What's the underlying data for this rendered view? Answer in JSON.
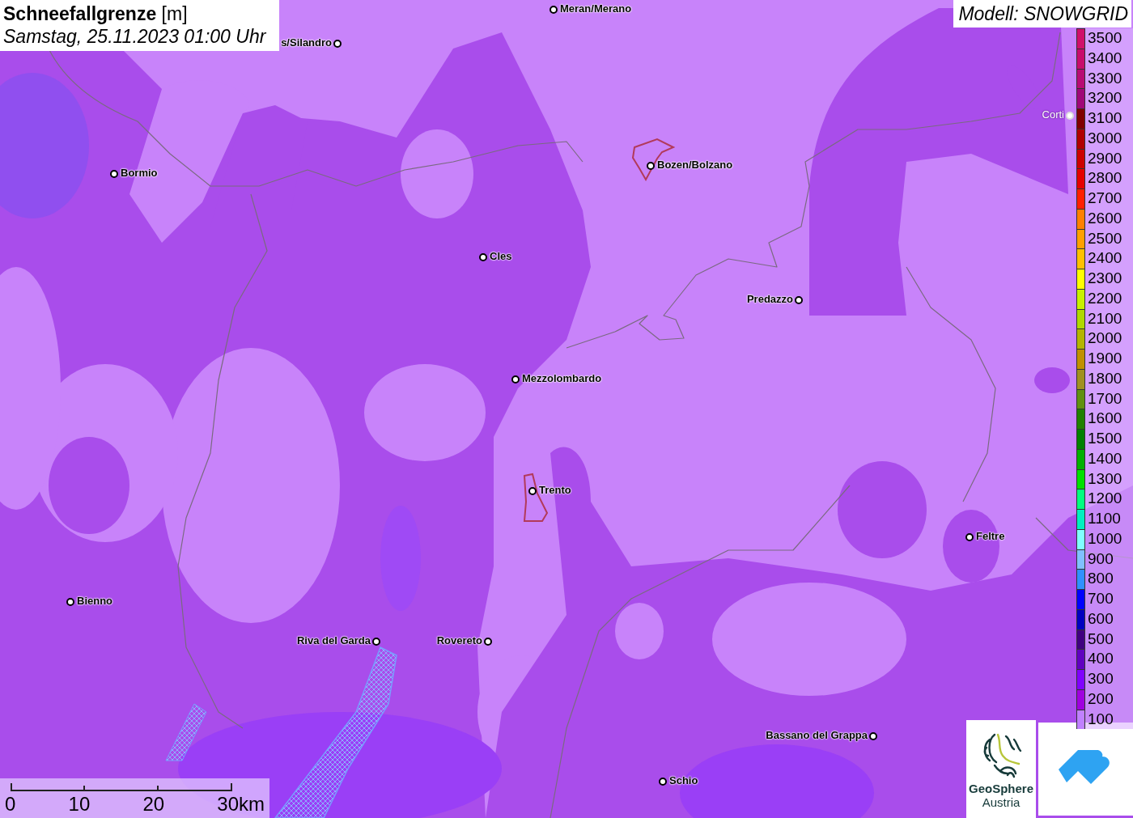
{
  "title": {
    "heading": "Schneefallgrenze",
    "unit": "[m]",
    "datetime": "Samstag, 25.11.2023 01:00 Uhr"
  },
  "model_label": "Modell: SNOWGRID",
  "places": [
    {
      "name": "s/Silandro",
      "kind": "city"
    },
    {
      "name": "Meran/Merano",
      "kind": "city"
    },
    {
      "name": "Bormio",
      "kind": "city"
    },
    {
      "name": "Bozen/Bolzano",
      "kind": "city"
    },
    {
      "name": "Corti",
      "kind": "faded"
    },
    {
      "name": "Cles",
      "kind": "city"
    },
    {
      "name": "Predazzo",
      "kind": "city"
    },
    {
      "name": "Mezzolombardo",
      "kind": "city"
    },
    {
      "name": "Trento",
      "kind": "city"
    },
    {
      "name": "Feltre",
      "kind": "city"
    },
    {
      "name": "Bienno",
      "kind": "city"
    },
    {
      "name": "Riva del Garda",
      "kind": "city"
    },
    {
      "name": "Rovereto",
      "kind": "city"
    },
    {
      "name": "Bassano del Grappa",
      "kind": "city"
    },
    {
      "name": "Schio",
      "kind": "city"
    }
  ],
  "legend": [
    {
      "label": "3500",
      "color": "#d0106a"
    },
    {
      "label": "3400",
      "color": "#c80c6c"
    },
    {
      "label": "3300",
      "color": "#b80c74"
    },
    {
      "label": "3200",
      "color": "#a00878"
    },
    {
      "label": "3100",
      "color": "#800000"
    },
    {
      "label": "3000",
      "color": "#b00000"
    },
    {
      "label": "2900",
      "color": "#cc0000"
    },
    {
      "label": "2800",
      "color": "#e40000"
    },
    {
      "label": "2700",
      "color": "#ff2000"
    },
    {
      "label": "2600",
      "color": "#ff8000"
    },
    {
      "label": "2500",
      "color": "#ffa000"
    },
    {
      "label": "2400",
      "color": "#ffc000"
    },
    {
      "label": "2300",
      "color": "#ffff00"
    },
    {
      "label": "2200",
      "color": "#c8f000"
    },
    {
      "label": "2100",
      "color": "#b0d800"
    },
    {
      "label": "2000",
      "color": "#b4b400"
    },
    {
      "label": "1900",
      "color": "#c09000"
    },
    {
      "label": "1800",
      "color": "#a09020"
    },
    {
      "label": "1700",
      "color": "#609010"
    },
    {
      "label": "1600",
      "color": "#208000"
    },
    {
      "label": "1500",
      "color": "#008000"
    },
    {
      "label": "1400",
      "color": "#00b000"
    },
    {
      "label": "1300",
      "color": "#00e000"
    },
    {
      "label": "1200",
      "color": "#00ff80"
    },
    {
      "label": "1100",
      "color": "#00f0c0"
    },
    {
      "label": "1000",
      "color": "#80ffff"
    },
    {
      "label": "900",
      "color": "#80c0ff"
    },
    {
      "label": "800",
      "color": "#3090ff"
    },
    {
      "label": "700",
      "color": "#0000ff"
    },
    {
      "label": "600",
      "color": "#0000c0"
    },
    {
      "label": "500",
      "color": "#400080"
    },
    {
      "label": "400",
      "color": "#6000c0"
    },
    {
      "label": "300",
      "color": "#8000ff"
    },
    {
      "label": "200",
      "color": "#a000e0"
    },
    {
      "label": "100",
      "color": "#c080ff"
    }
  ],
  "scale_bar": {
    "ticks": [
      "0",
      "10",
      "20",
      "30km"
    ]
  },
  "logos": [
    {
      "kind": "geosphere",
      "name": "GeoSphere",
      "subtitle": "Austria"
    },
    {
      "kind": "cloud-house"
    }
  ]
}
